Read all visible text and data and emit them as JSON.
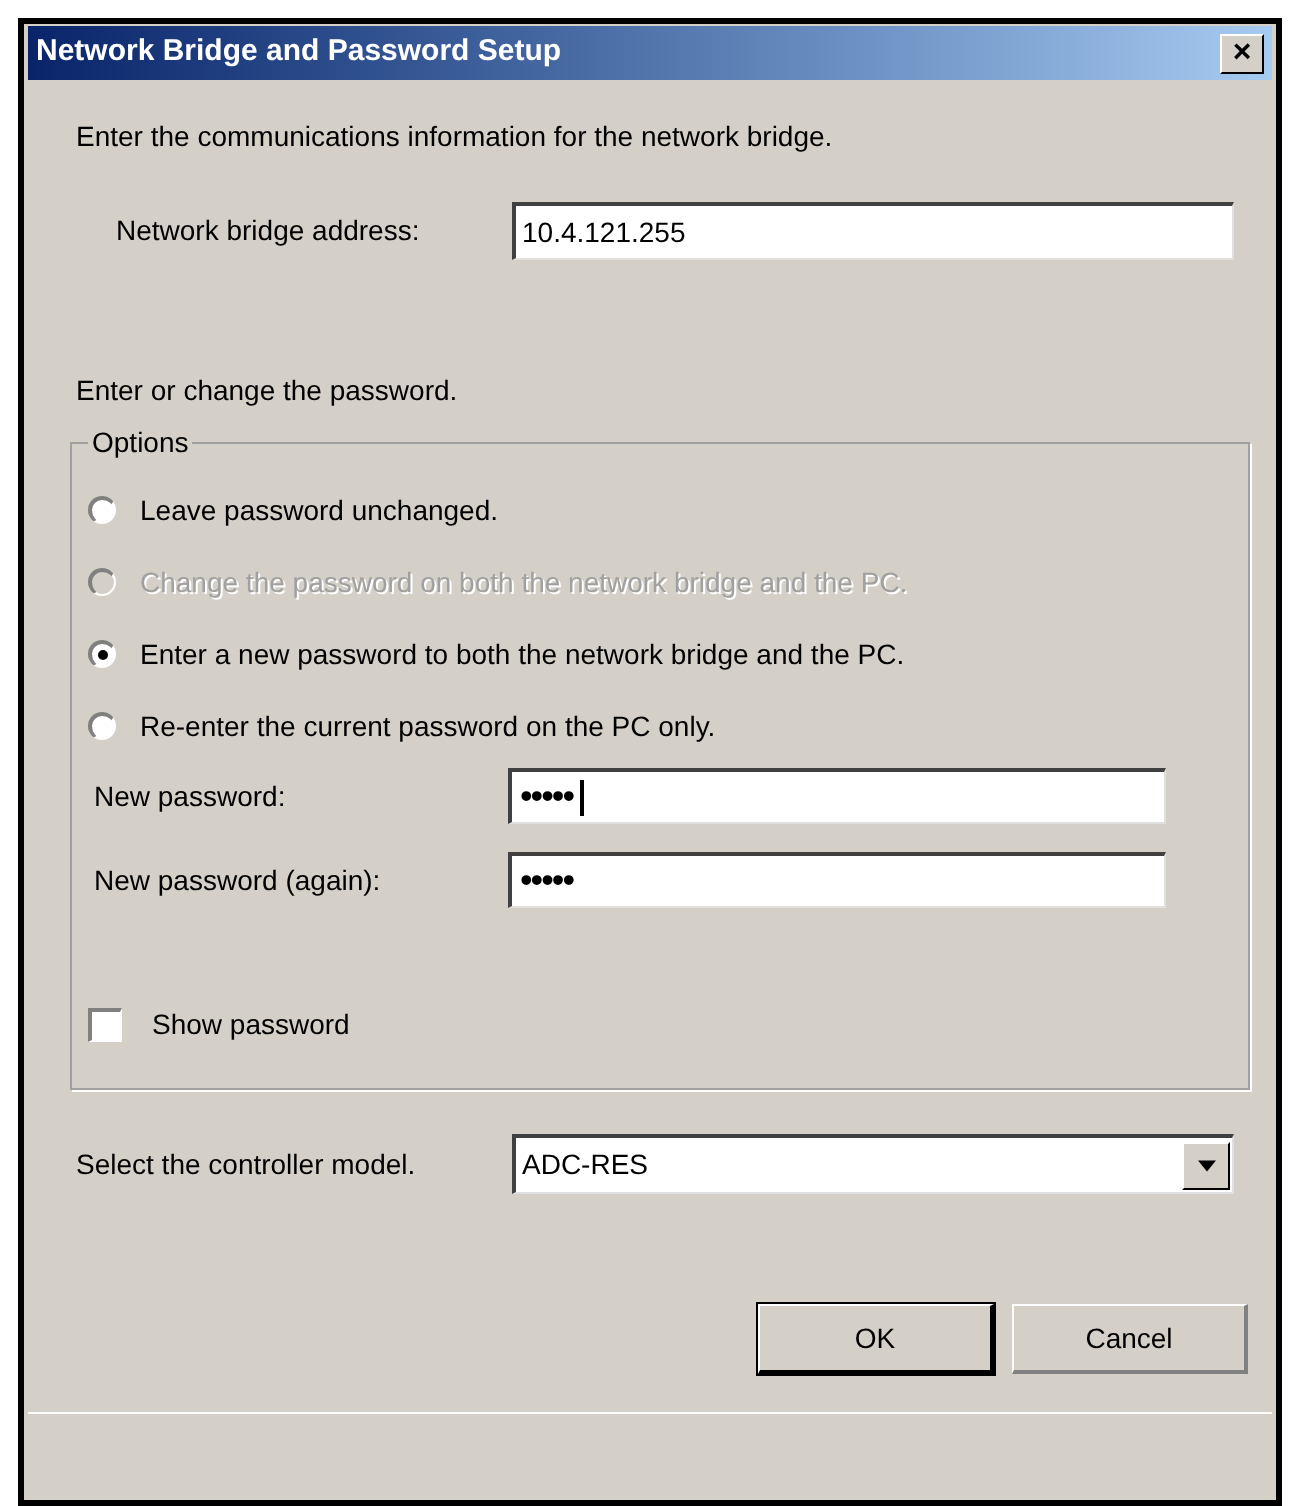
{
  "window": {
    "title": "Network Bridge and Password Setup",
    "close": "×"
  },
  "intro": "Enter the communications information for the network bridge.",
  "address": {
    "label": "Network bridge address:",
    "value": "10.4.121.255"
  },
  "password_intro": "Enter or change the password.",
  "options": {
    "title": "Options",
    "radios": [
      {
        "label": "Leave password unchanged.",
        "selected": false,
        "disabled": false
      },
      {
        "label": "Change the password on both the network bridge and the PC.",
        "selected": false,
        "disabled": true
      },
      {
        "label": "Enter a new password to both the network bridge and the PC.",
        "selected": true,
        "disabled": false
      },
      {
        "label": "Re-enter the current password on the PC only.",
        "selected": false,
        "disabled": false
      }
    ],
    "fields": [
      {
        "label": "New password:",
        "value": "•••••",
        "focused": true
      },
      {
        "label": "New password (again):",
        "value": "•••••",
        "focused": false
      }
    ],
    "show_password": {
      "label": "Show password",
      "checked": false
    }
  },
  "model": {
    "label": "Select the controller model.",
    "value": "ADC-RES"
  },
  "buttons": [
    "OK",
    "Cancel"
  ]
}
